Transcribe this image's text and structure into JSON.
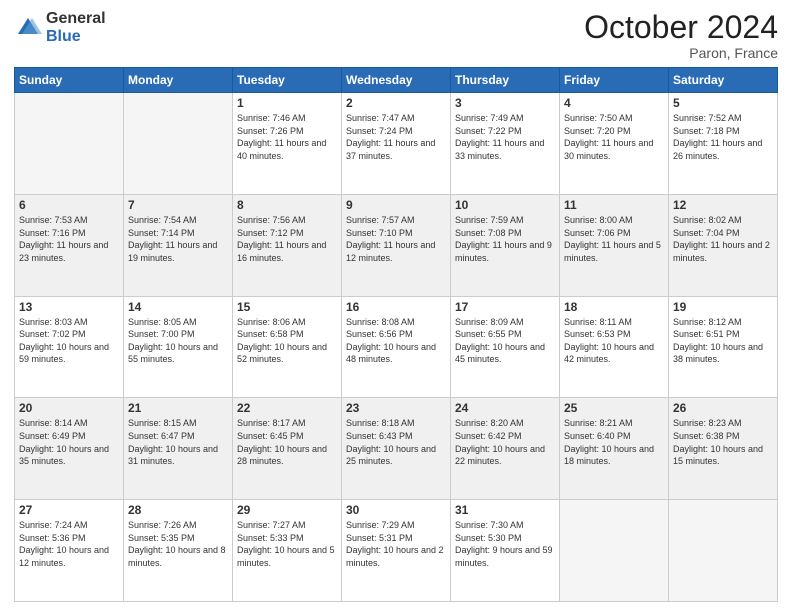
{
  "logo": {
    "general": "General",
    "blue": "Blue"
  },
  "header": {
    "month": "October 2024",
    "location": "Paron, France"
  },
  "days_of_week": [
    "Sunday",
    "Monday",
    "Tuesday",
    "Wednesday",
    "Thursday",
    "Friday",
    "Saturday"
  ],
  "weeks": [
    [
      {
        "day": "",
        "empty": true
      },
      {
        "day": "",
        "empty": true
      },
      {
        "day": "1",
        "sunrise": "Sunrise: 7:46 AM",
        "sunset": "Sunset: 7:26 PM",
        "daylight": "Daylight: 11 hours and 40 minutes."
      },
      {
        "day": "2",
        "sunrise": "Sunrise: 7:47 AM",
        "sunset": "Sunset: 7:24 PM",
        "daylight": "Daylight: 11 hours and 37 minutes."
      },
      {
        "day": "3",
        "sunrise": "Sunrise: 7:49 AM",
        "sunset": "Sunset: 7:22 PM",
        "daylight": "Daylight: 11 hours and 33 minutes."
      },
      {
        "day": "4",
        "sunrise": "Sunrise: 7:50 AM",
        "sunset": "Sunset: 7:20 PM",
        "daylight": "Daylight: 11 hours and 30 minutes."
      },
      {
        "day": "5",
        "sunrise": "Sunrise: 7:52 AM",
        "sunset": "Sunset: 7:18 PM",
        "daylight": "Daylight: 11 hours and 26 minutes."
      }
    ],
    [
      {
        "day": "6",
        "sunrise": "Sunrise: 7:53 AM",
        "sunset": "Sunset: 7:16 PM",
        "daylight": "Daylight: 11 hours and 23 minutes."
      },
      {
        "day": "7",
        "sunrise": "Sunrise: 7:54 AM",
        "sunset": "Sunset: 7:14 PM",
        "daylight": "Daylight: 11 hours and 19 minutes."
      },
      {
        "day": "8",
        "sunrise": "Sunrise: 7:56 AM",
        "sunset": "Sunset: 7:12 PM",
        "daylight": "Daylight: 11 hours and 16 minutes."
      },
      {
        "day": "9",
        "sunrise": "Sunrise: 7:57 AM",
        "sunset": "Sunset: 7:10 PM",
        "daylight": "Daylight: 11 hours and 12 minutes."
      },
      {
        "day": "10",
        "sunrise": "Sunrise: 7:59 AM",
        "sunset": "Sunset: 7:08 PM",
        "daylight": "Daylight: 11 hours and 9 minutes."
      },
      {
        "day": "11",
        "sunrise": "Sunrise: 8:00 AM",
        "sunset": "Sunset: 7:06 PM",
        "daylight": "Daylight: 11 hours and 5 minutes."
      },
      {
        "day": "12",
        "sunrise": "Sunrise: 8:02 AM",
        "sunset": "Sunset: 7:04 PM",
        "daylight": "Daylight: 11 hours and 2 minutes."
      }
    ],
    [
      {
        "day": "13",
        "sunrise": "Sunrise: 8:03 AM",
        "sunset": "Sunset: 7:02 PM",
        "daylight": "Daylight: 10 hours and 59 minutes."
      },
      {
        "day": "14",
        "sunrise": "Sunrise: 8:05 AM",
        "sunset": "Sunset: 7:00 PM",
        "daylight": "Daylight: 10 hours and 55 minutes."
      },
      {
        "day": "15",
        "sunrise": "Sunrise: 8:06 AM",
        "sunset": "Sunset: 6:58 PM",
        "daylight": "Daylight: 10 hours and 52 minutes."
      },
      {
        "day": "16",
        "sunrise": "Sunrise: 8:08 AM",
        "sunset": "Sunset: 6:56 PM",
        "daylight": "Daylight: 10 hours and 48 minutes."
      },
      {
        "day": "17",
        "sunrise": "Sunrise: 8:09 AM",
        "sunset": "Sunset: 6:55 PM",
        "daylight": "Daylight: 10 hours and 45 minutes."
      },
      {
        "day": "18",
        "sunrise": "Sunrise: 8:11 AM",
        "sunset": "Sunset: 6:53 PM",
        "daylight": "Daylight: 10 hours and 42 minutes."
      },
      {
        "day": "19",
        "sunrise": "Sunrise: 8:12 AM",
        "sunset": "Sunset: 6:51 PM",
        "daylight": "Daylight: 10 hours and 38 minutes."
      }
    ],
    [
      {
        "day": "20",
        "sunrise": "Sunrise: 8:14 AM",
        "sunset": "Sunset: 6:49 PM",
        "daylight": "Daylight: 10 hours and 35 minutes."
      },
      {
        "day": "21",
        "sunrise": "Sunrise: 8:15 AM",
        "sunset": "Sunset: 6:47 PM",
        "daylight": "Daylight: 10 hours and 31 minutes."
      },
      {
        "day": "22",
        "sunrise": "Sunrise: 8:17 AM",
        "sunset": "Sunset: 6:45 PM",
        "daylight": "Daylight: 10 hours and 28 minutes."
      },
      {
        "day": "23",
        "sunrise": "Sunrise: 8:18 AM",
        "sunset": "Sunset: 6:43 PM",
        "daylight": "Daylight: 10 hours and 25 minutes."
      },
      {
        "day": "24",
        "sunrise": "Sunrise: 8:20 AM",
        "sunset": "Sunset: 6:42 PM",
        "daylight": "Daylight: 10 hours and 22 minutes."
      },
      {
        "day": "25",
        "sunrise": "Sunrise: 8:21 AM",
        "sunset": "Sunset: 6:40 PM",
        "daylight": "Daylight: 10 hours and 18 minutes."
      },
      {
        "day": "26",
        "sunrise": "Sunrise: 8:23 AM",
        "sunset": "Sunset: 6:38 PM",
        "daylight": "Daylight: 10 hours and 15 minutes."
      }
    ],
    [
      {
        "day": "27",
        "sunrise": "Sunrise: 7:24 AM",
        "sunset": "Sunset: 5:36 PM",
        "daylight": "Daylight: 10 hours and 12 minutes."
      },
      {
        "day": "28",
        "sunrise": "Sunrise: 7:26 AM",
        "sunset": "Sunset: 5:35 PM",
        "daylight": "Daylight: 10 hours and 8 minutes."
      },
      {
        "day": "29",
        "sunrise": "Sunrise: 7:27 AM",
        "sunset": "Sunset: 5:33 PM",
        "daylight": "Daylight: 10 hours and 5 minutes."
      },
      {
        "day": "30",
        "sunrise": "Sunrise: 7:29 AM",
        "sunset": "Sunset: 5:31 PM",
        "daylight": "Daylight: 10 hours and 2 minutes."
      },
      {
        "day": "31",
        "sunrise": "Sunrise: 7:30 AM",
        "sunset": "Sunset: 5:30 PM",
        "daylight": "Daylight: 9 hours and 59 minutes."
      },
      {
        "day": "",
        "empty": true
      },
      {
        "day": "",
        "empty": true
      }
    ]
  ]
}
